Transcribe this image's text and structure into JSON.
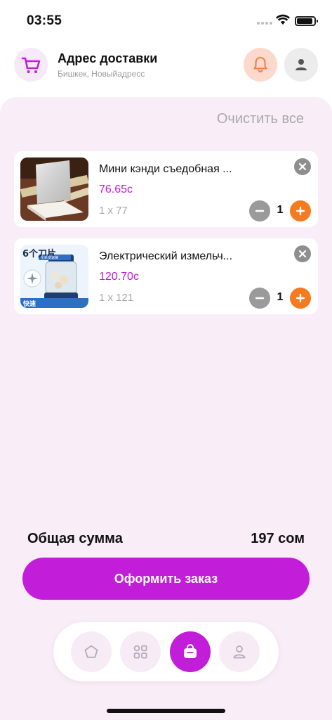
{
  "status_bar": {
    "time": "03:55"
  },
  "header": {
    "title": "Адрес доставки",
    "subtitle": "Бишкек, Новыйадресс"
  },
  "cart": {
    "clear_all_label": "Очистить все",
    "items": [
      {
        "name": "Мини кэнди съедобная ...",
        "price": "76.65с",
        "qty_line": "1 x 77",
        "quantity": "1"
      },
      {
        "name": "Электрический измельч...",
        "price": "120.70с",
        "qty_line": "1 x 121",
        "quantity": "1"
      }
    ]
  },
  "summary": {
    "total_label": "Общая сумма",
    "total_value": "197 сом"
  },
  "checkout_button_label": "Оформить заказ",
  "thumbnail_texts": {
    "blade_title": "6个刀片",
    "blade_badge": "全新变速械",
    "fast_label": "快速"
  },
  "icons": {
    "cart_logo": "shopping-cart-icon",
    "bell": "bell-icon",
    "profile": "user-icon",
    "remove": "close-icon",
    "minus": "minus-icon",
    "plus": "plus-icon",
    "nav_home": "pentagon-home-icon",
    "nav_catalog": "grid-icon",
    "nav_cart": "bag-icon",
    "nav_profile": "user-icon"
  },
  "colors": {
    "accent": "#c21ed9",
    "price": "#c218d8",
    "plus_button": "#f57a20",
    "bell_bg": "#fcd9cc",
    "background": "#f9edf8"
  }
}
